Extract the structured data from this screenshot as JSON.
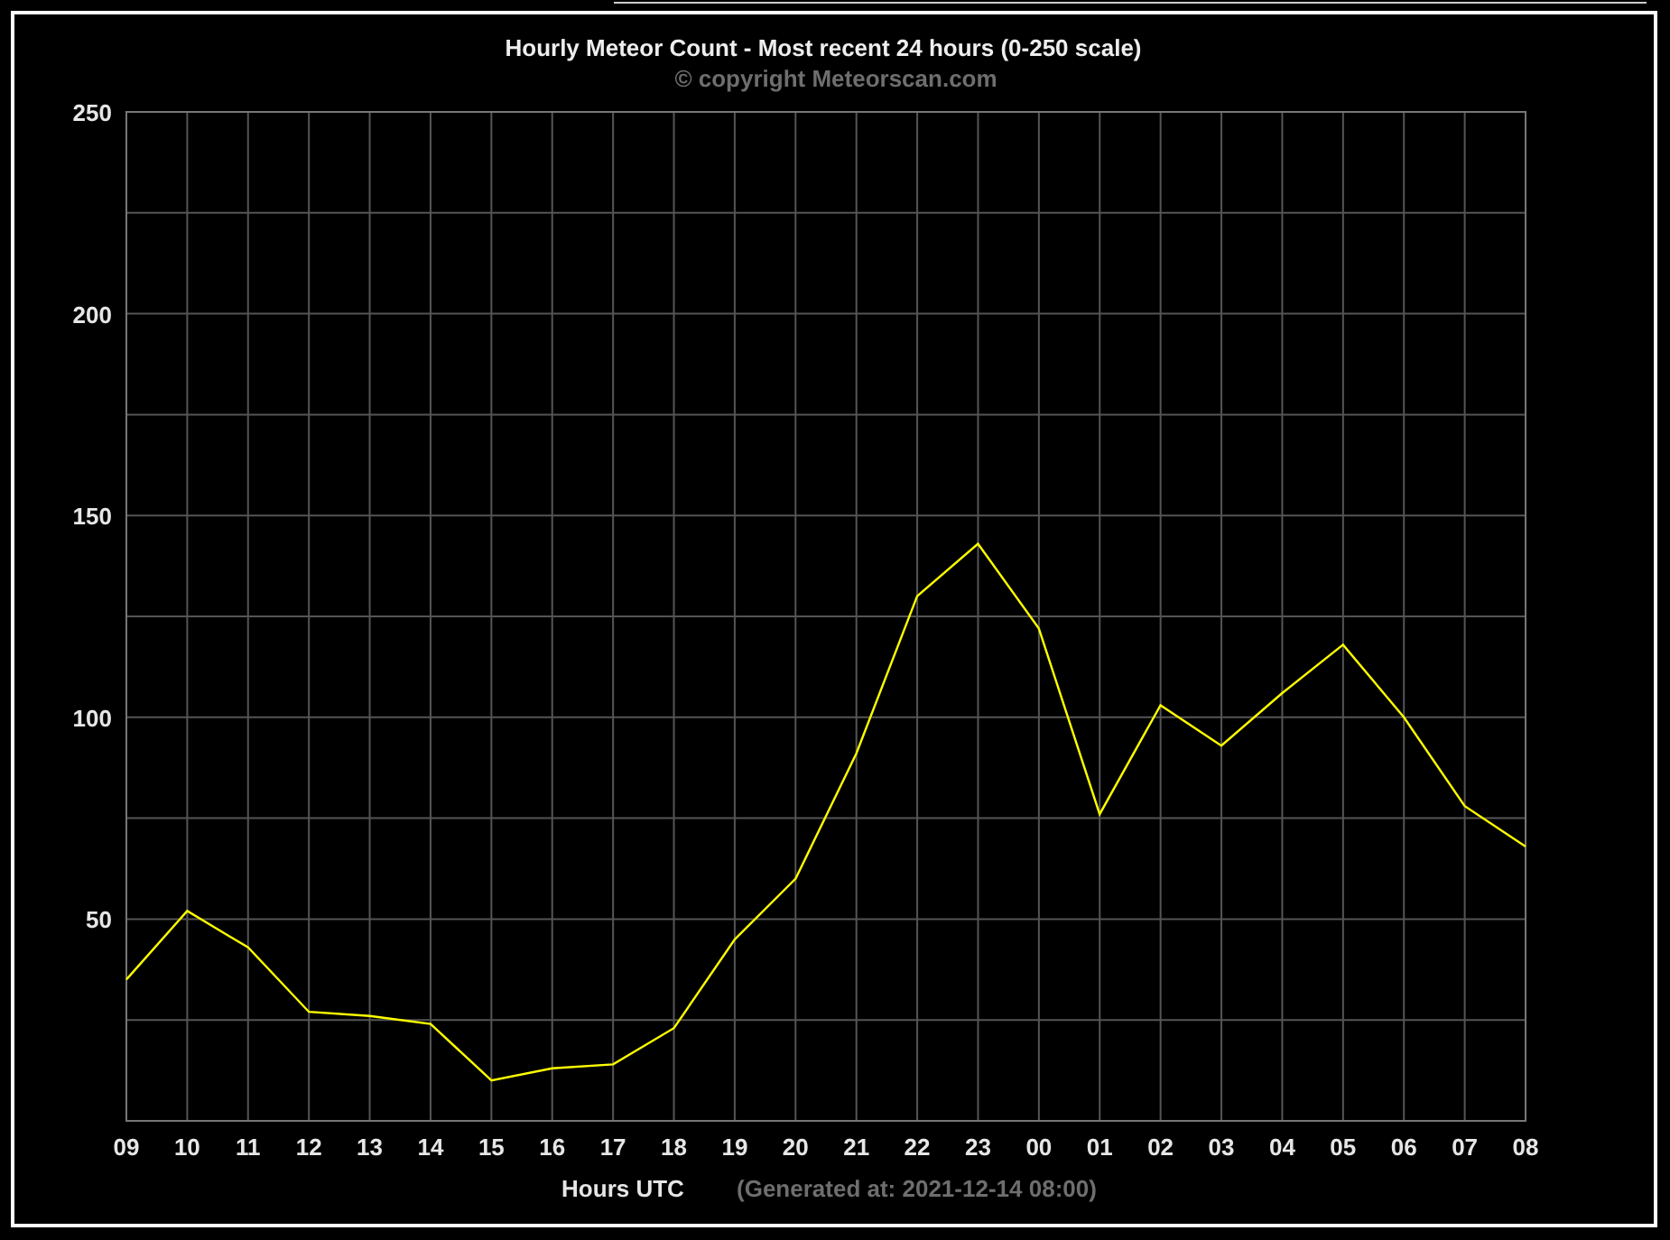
{
  "title": "Hourly Meteor Count - Most recent 24 hours (0-250 scale)",
  "copyright": "© copyright Meteorscan.com",
  "chart_data": {
    "type": "line",
    "xlabel": "Hours UTC",
    "categories": [
      "09",
      "10",
      "11",
      "12",
      "13",
      "14",
      "15",
      "16",
      "17",
      "18",
      "19",
      "20",
      "21",
      "22",
      "23",
      "00",
      "01",
      "02",
      "03",
      "04",
      "05",
      "06",
      "07",
      "08"
    ],
    "series": [
      {
        "color": "#ffff00",
        "values": [
          35,
          52,
          43,
          27,
          26,
          24,
          10,
          13,
          14,
          23,
          45,
          60,
          91,
          130,
          143,
          122,
          76,
          103,
          93,
          106,
          118,
          100,
          78,
          68
        ]
      }
    ],
    "ylim": [
      0,
      250
    ],
    "grid": true,
    "yticks": [
      50,
      100,
      150,
      200,
      250
    ]
  },
  "generated": "(Generated at: 2021-12-14 08:00)"
}
